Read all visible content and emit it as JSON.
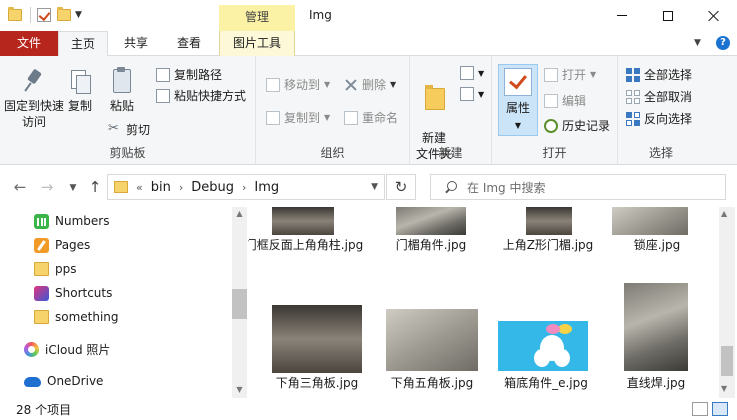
{
  "window": {
    "title": "Img",
    "context_tab": "管理",
    "minimize": "minimize",
    "maximize": "maximize",
    "close": "close"
  },
  "tabs": [
    "文件",
    "主页",
    "共享",
    "查看",
    "图片工具"
  ],
  "ribbon": {
    "clipboard": {
      "label": "剪贴板",
      "pin": "固定到快速访问",
      "copy": "复制",
      "paste": "粘贴",
      "copy_path": "复制路径",
      "paste_shortcut": "粘贴快捷方式",
      "cut": "剪切"
    },
    "organize": {
      "label": "组织",
      "move_to": "移动到",
      "copy_to": "复制到",
      "delete": "删除",
      "rename": "重命名"
    },
    "new": {
      "label": "新建",
      "new_folder": "新建\n文件夹"
    },
    "open": {
      "label": "打开",
      "properties": "属性",
      "open": "打开",
      "edit": "编辑",
      "history": "历史记录"
    },
    "select": {
      "label": "选择",
      "select_all": "全部选择",
      "select_none": "全部取消",
      "invert": "反向选择"
    }
  },
  "address": {
    "prefix": "«",
    "crumbs": [
      "bin",
      "Debug",
      "Img"
    ]
  },
  "search": {
    "placeholder": "在 Img 中搜索"
  },
  "nav_items": [
    {
      "label": "Numbers",
      "icon": "numbers-app-icon"
    },
    {
      "label": "Pages",
      "icon": "pages-app-icon"
    },
    {
      "label": "pps",
      "icon": "folder-icon"
    },
    {
      "label": "Shortcuts",
      "icon": "shortcuts-app-icon"
    },
    {
      "label": "something",
      "icon": "folder-icon"
    },
    {
      "label": "iCloud 照片",
      "icon": "icloud-photos-icon"
    },
    {
      "label": "OneDrive",
      "icon": "onedrive-icon"
    }
  ],
  "files_row1": [
    {
      "name": "门框反面上角角柱.jpg"
    },
    {
      "name": "门楣角件.jpg"
    },
    {
      "name": "上角Z形门楣.jpg"
    },
    {
      "name": "锁座.jpg"
    }
  ],
  "files_row2": [
    {
      "name": "下角三角板.jpg"
    },
    {
      "name": "下角五角板.jpg"
    },
    {
      "name": "箱底角件_e.jpg"
    },
    {
      "name": "直线焊.jpg"
    }
  ],
  "status": {
    "item_count": "28 个项目"
  }
}
